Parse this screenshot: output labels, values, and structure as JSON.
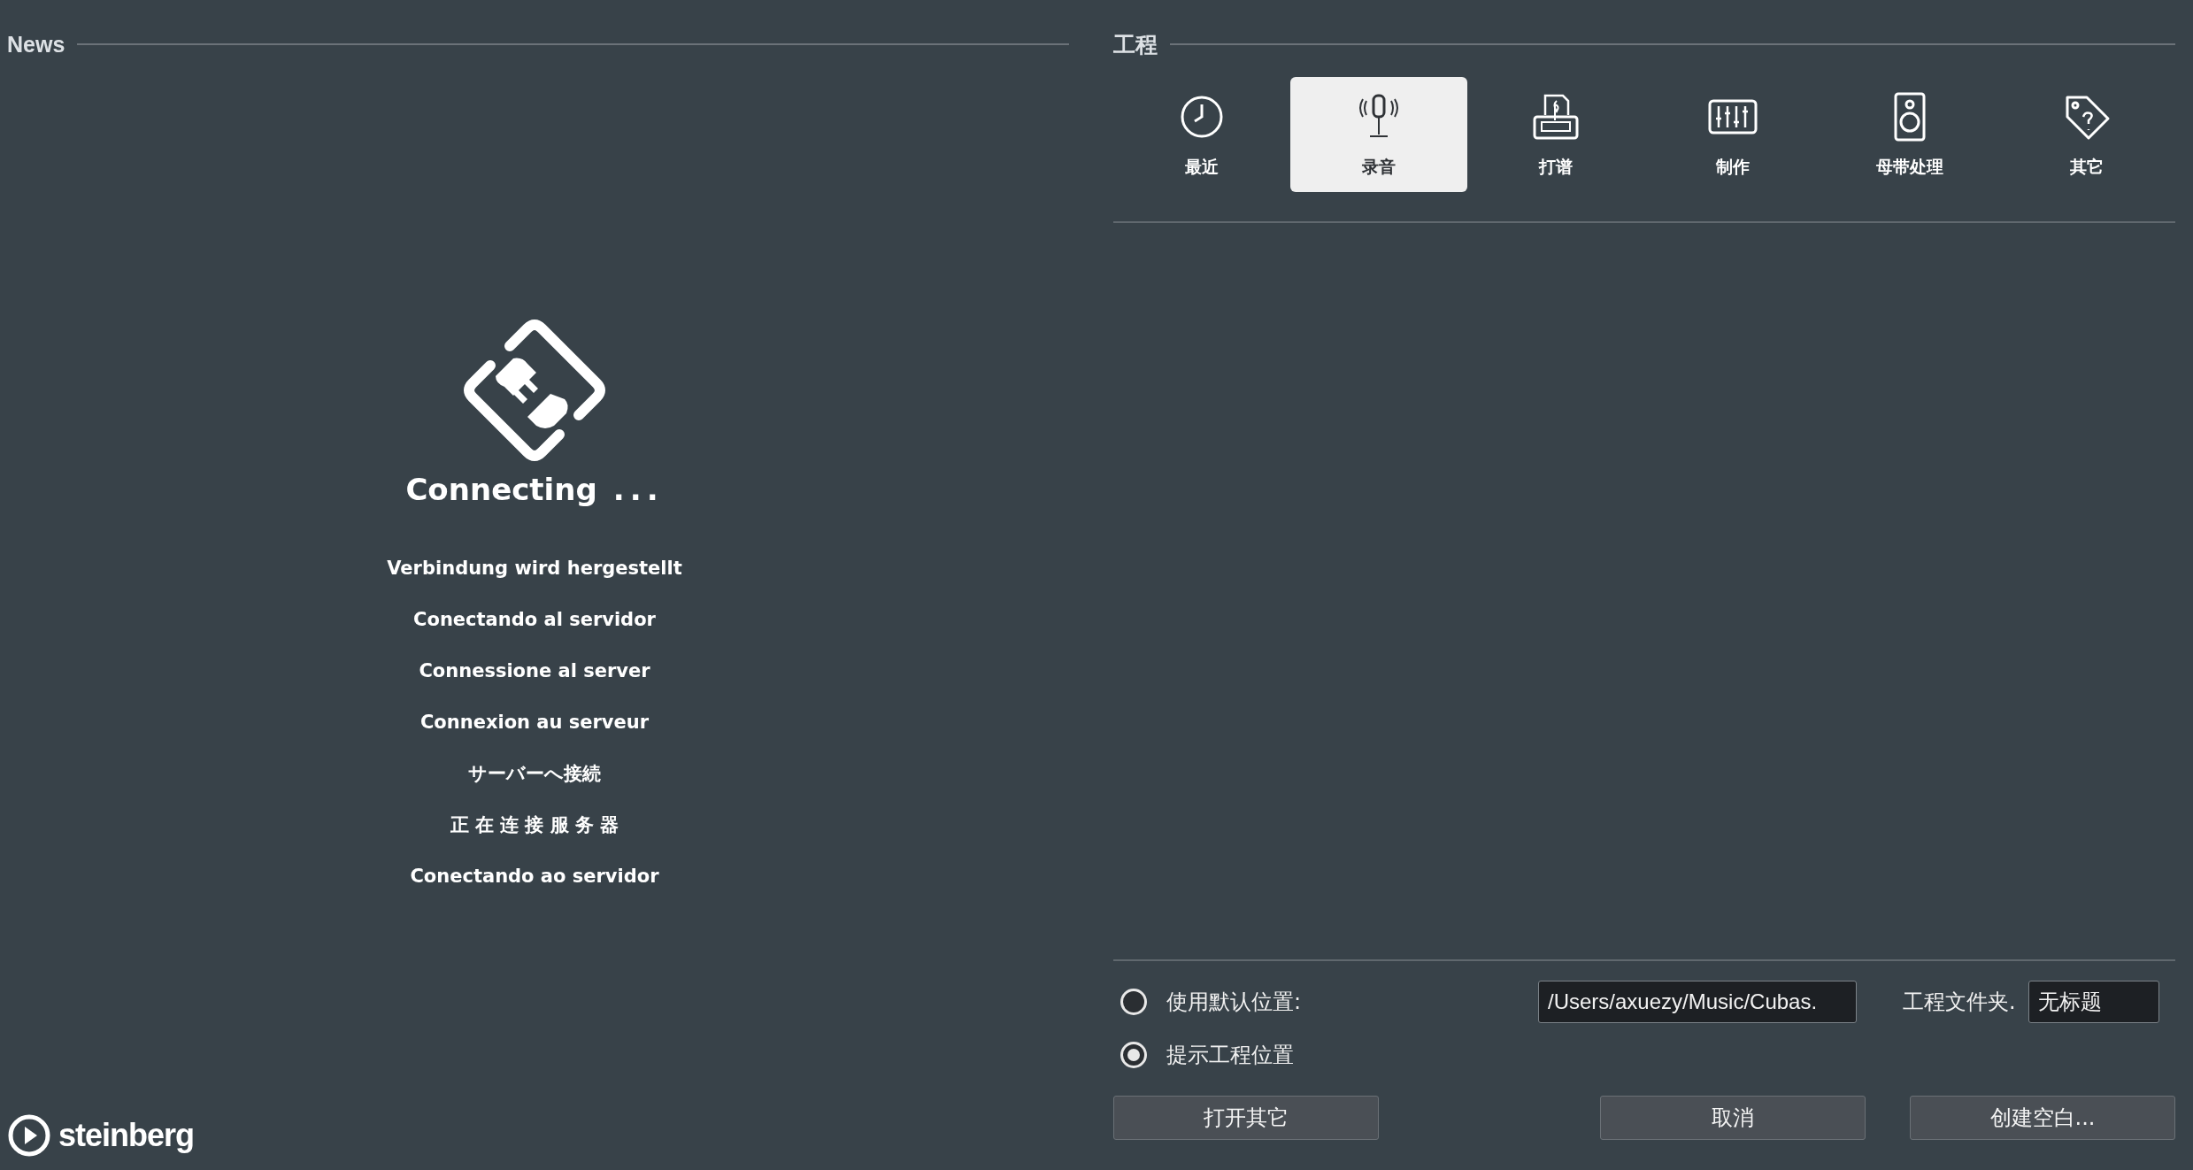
{
  "news": {
    "title": "News",
    "status": "Connecting",
    "status_dots": "...",
    "messages": [
      "Verbindung wird hergestellt",
      "Conectando al servidor",
      "Connessione al server",
      "Connexion au serveur",
      "サーバーへ接続",
      "正 在 连 接 服 务 器",
      "Conectando ao servidor"
    ],
    "logo": "steinberg"
  },
  "project": {
    "title": "工程",
    "tabs": [
      {
        "label": "最近",
        "kind": "clock",
        "selected": false
      },
      {
        "label": "录音",
        "kind": "microphone",
        "selected": true
      },
      {
        "label": "打谱",
        "kind": "score",
        "selected": false
      },
      {
        "label": "制作",
        "kind": "mixer",
        "selected": false
      },
      {
        "label": "母带处理",
        "kind": "speaker",
        "selected": false
      },
      {
        "label": "其它",
        "kind": "tag",
        "selected": false
      }
    ],
    "locations": [
      {
        "label": "使用默认位置:",
        "selected": false
      },
      {
        "label": "提示工程位置",
        "selected": true
      }
    ],
    "path": "/Users/axuezy/Music/Cubas.",
    "folder_label": "工程文件夹.",
    "folder_name": "无标题",
    "buttons": [
      "打开其它",
      "取消",
      "创建空白..."
    ]
  }
}
